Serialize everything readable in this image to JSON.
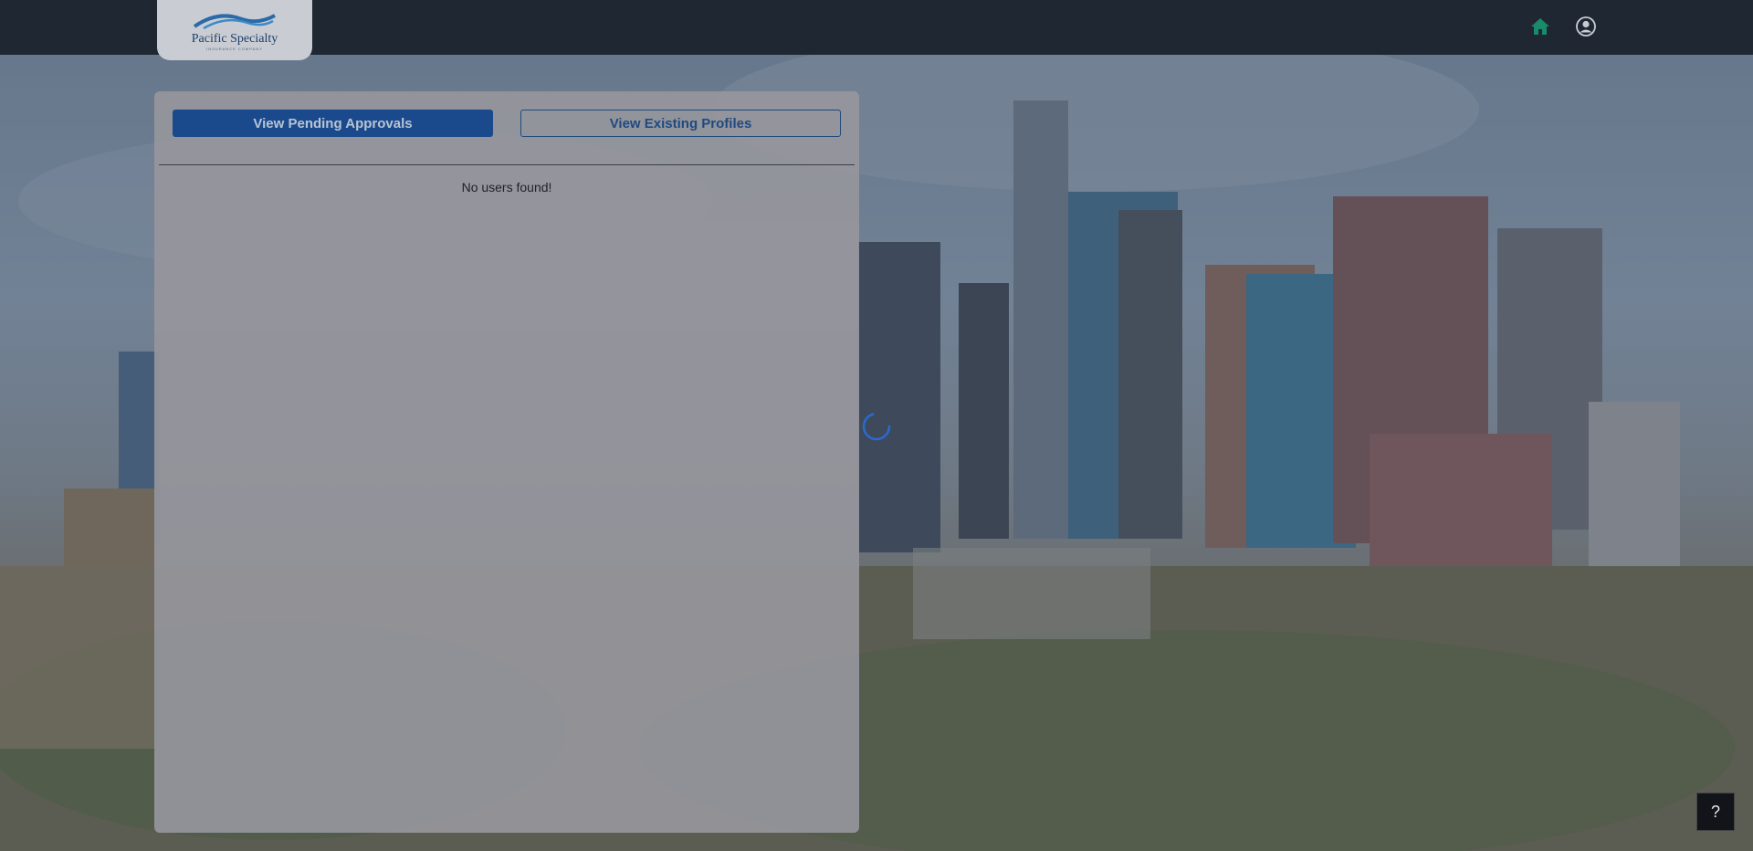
{
  "header": {
    "logo": {
      "name": "Pacific Specialty",
      "subtext": "INSURANCE COMPANY"
    },
    "icons": {
      "home": "home-icon",
      "user": "user-account-icon"
    },
    "colors": {
      "navbar": "#1f2733",
      "home_icon": "#1a8a6a"
    }
  },
  "main": {
    "buttons": {
      "pending": "View Pending Approvals",
      "existing": "View Existing Profiles"
    },
    "empty_message": "No users found!"
  },
  "help": {
    "label": "?"
  },
  "status": {
    "loading": true
  }
}
